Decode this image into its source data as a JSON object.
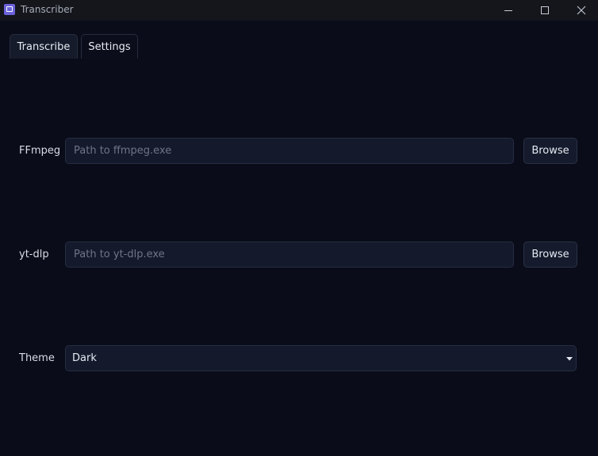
{
  "window": {
    "title": "Transcriber",
    "controls": [
      "minimize-icon",
      "maximize-icon",
      "close-icon"
    ]
  },
  "tabs": [
    {
      "label": "Transcribe",
      "active": false
    },
    {
      "label": "Settings",
      "active": true
    }
  ],
  "settings": {
    "ffmpeg": {
      "label": "FFmpeg",
      "value": "",
      "placeholder": "Path to ffmpeg.exe",
      "button": "Browse"
    },
    "ytdlp": {
      "label": "yt-dlp",
      "value": "",
      "placeholder": "Path to yt-dlp.exe",
      "button": "Browse"
    },
    "theme": {
      "label": "Theme",
      "selected": "Dark",
      "icon": "chevron-down-icon"
    }
  },
  "colors": {
    "background": "#0a0d19",
    "titlebar": "#14161c",
    "field": "#141a2c",
    "border": "#262d42",
    "text": "#e6e9f2",
    "placeholder": "#6e7587",
    "app_icon": "#6b63d8"
  }
}
